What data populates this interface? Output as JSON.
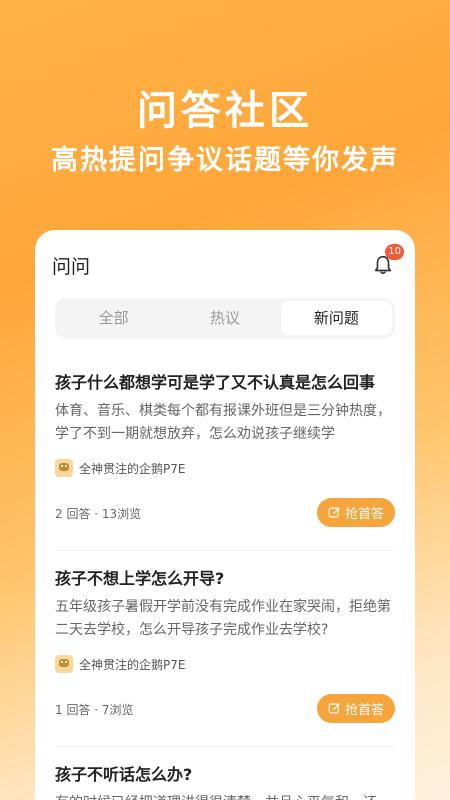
{
  "hero": {
    "title": "问答社区",
    "subtitle": "高热提问争议话题等你发声"
  },
  "header": {
    "title": "问问",
    "notification_count": "10"
  },
  "tabs": [
    {
      "label": "全部",
      "active": false
    },
    {
      "label": "热议",
      "active": false
    },
    {
      "label": "新问题",
      "active": true
    }
  ],
  "questions": [
    {
      "title": "孩子什么都想学可是学了又不认真是怎么回事",
      "body": "体育、音乐、棋类每个都有报课外班但是三分钟热度，学了不到一期就想放弃，怎么劝说孩子继续学",
      "author": "全神贯注的企鹅P7E",
      "stats": "2 回答 · 13浏览",
      "action": "抢首答"
    },
    {
      "title": "孩子不想上学怎么开导?",
      "body": "五年级孩子暑假开学前没有完成作业在家哭闹，拒绝第二天去学校，怎么开导孩子完成作业去学校?",
      "author": "全神贯注的企鹅P7E",
      "stats": "1 回答 · 7浏览",
      "action": "抢首答"
    },
    {
      "title": "孩子不听话怎么办?",
      "body": "有的时候已经把道理讲得很清楚，并且心平气和，还",
      "author": "",
      "stats": "",
      "action": ""
    }
  ],
  "colors": {
    "accent": "#f6a53c",
    "badge": "#f15a3a"
  }
}
